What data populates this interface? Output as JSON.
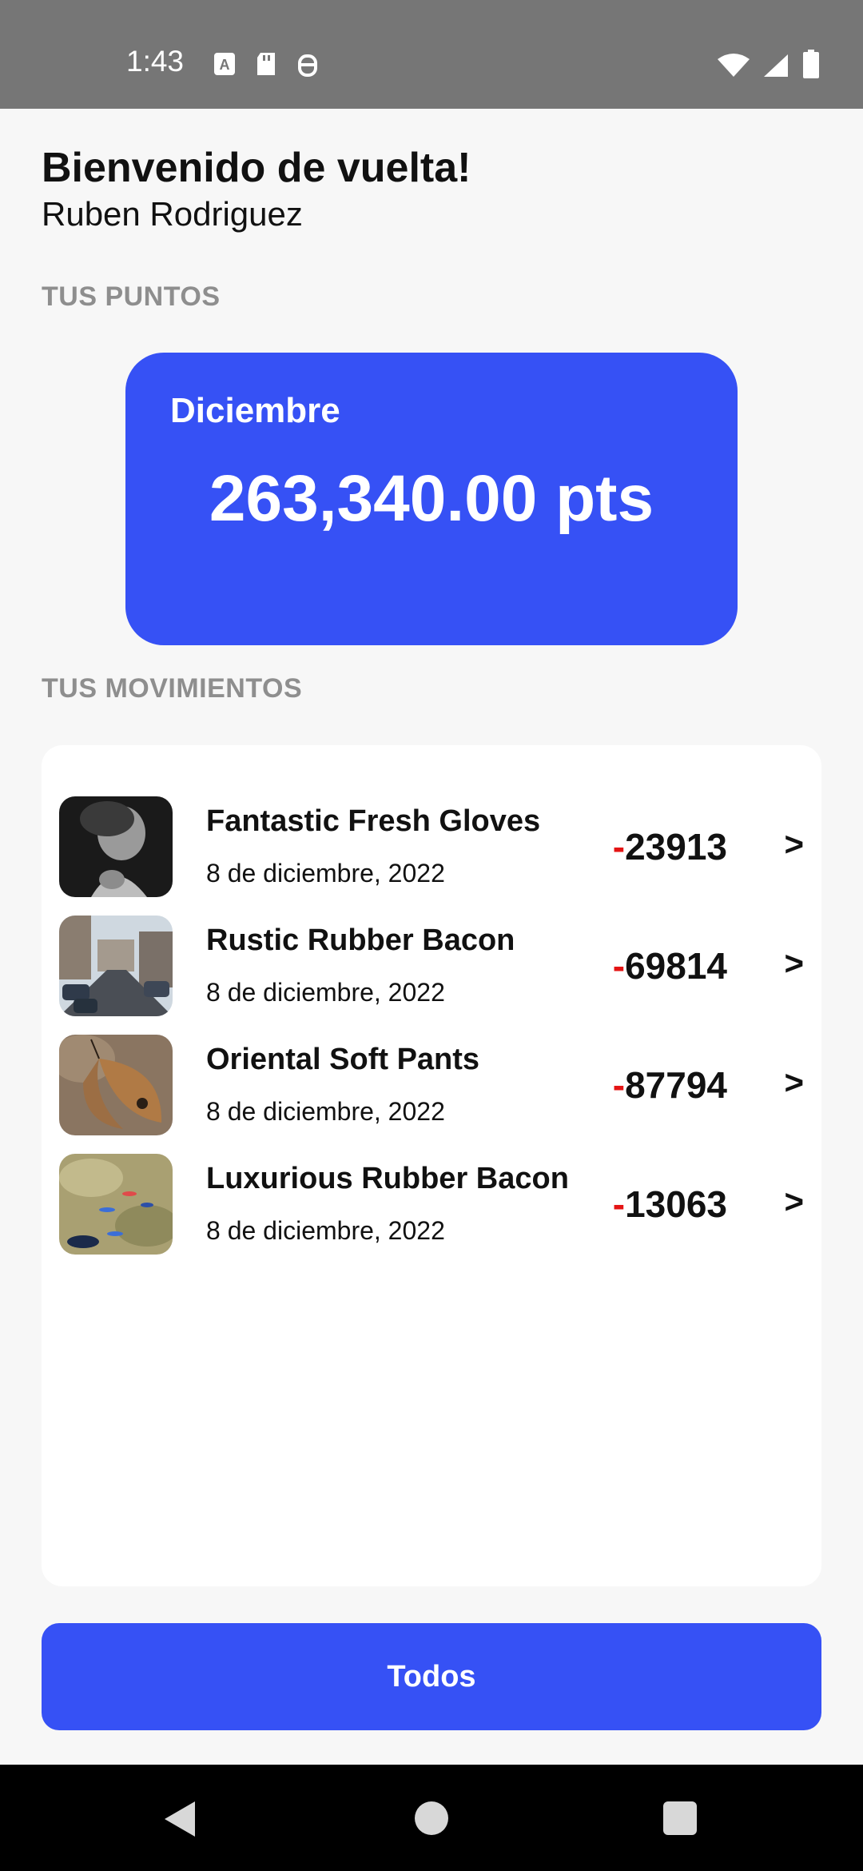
{
  "status_bar": {
    "time": "1:43",
    "icons_left": [
      "translate-icon",
      "sd-card-icon",
      "debug-icon"
    ],
    "icons_right": [
      "wifi-icon",
      "signal-icon",
      "battery-icon"
    ]
  },
  "header": {
    "title": "Bienvenido de vuelta!",
    "user_name": "Ruben Rodriguez"
  },
  "points_section": {
    "label": "TUS PUNTOS",
    "month": "Diciembre",
    "value": "263,340.00 pts",
    "card_color": "#3651f5"
  },
  "moves_section": {
    "label": "TUS MOVIMIENTOS",
    "items": [
      {
        "title": "Fantastic Fresh Gloves",
        "date": "8 de diciembre, 2022",
        "sign": "-",
        "amount": "23913",
        "arrow": ">",
        "image": "child-photo"
      },
      {
        "title": "Rustic Rubber Bacon",
        "date": "8 de diciembre, 2022",
        "sign": "-",
        "amount": "69814",
        "arrow": ">",
        "image": "street-photo"
      },
      {
        "title": "Oriental Soft Pants",
        "date": "8 de diciembre, 2022",
        "sign": "-",
        "amount": "87794",
        "arrow": ">",
        "image": "butterfly-photo"
      },
      {
        "title": "Luxurious Rubber Bacon",
        "date": "8 de diciembre, 2022",
        "sign": "-",
        "amount": "13063",
        "arrow": ">",
        "image": "fish-photo"
      }
    ]
  },
  "footer": {
    "button_label": "Todos",
    "accent_color": "#3651f5",
    "negative_color": "#e41414"
  },
  "nav_bar": {
    "icons": [
      "back-icon",
      "home-icon",
      "recents-icon"
    ]
  }
}
